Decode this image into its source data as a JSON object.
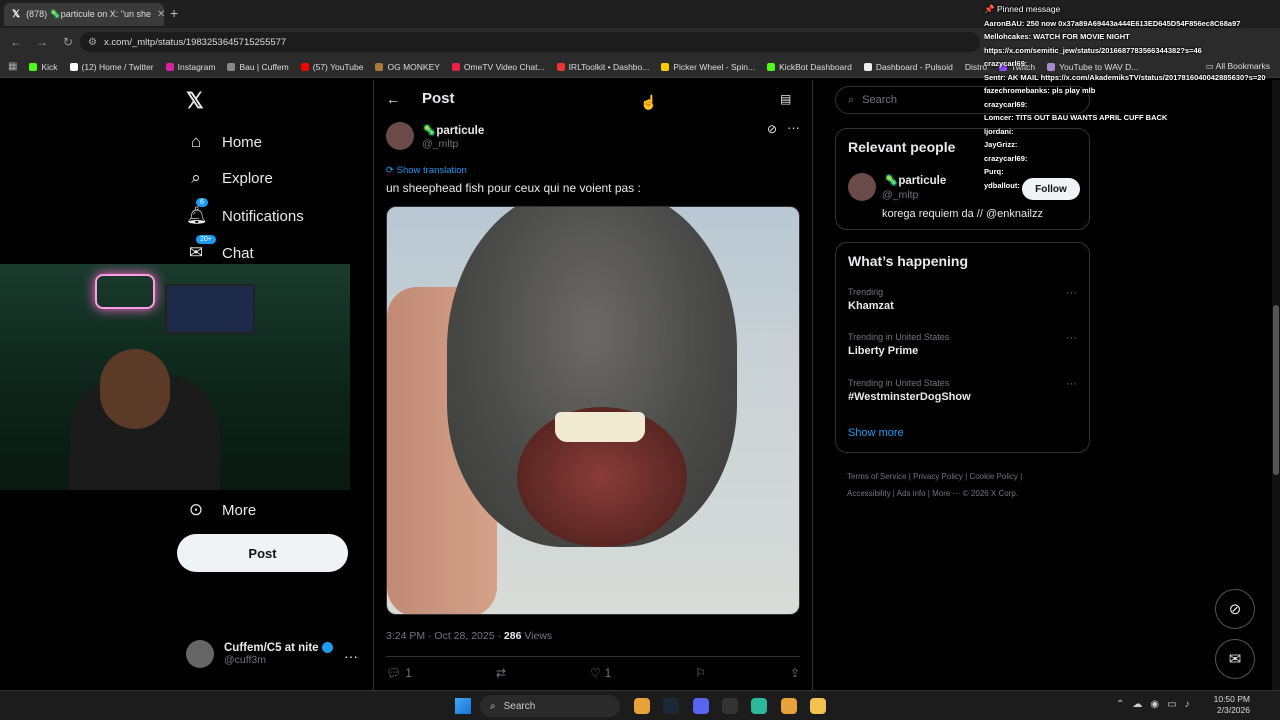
{
  "browser": {
    "tab_title": "(878) 🦠particule on X: \"un she",
    "url": "x.com/_mltp/status/1983253645715255577",
    "bookmarks": [
      "Kick",
      "(12) Home / Twitter",
      "Instagram",
      "Bau | Cuffem",
      "(57) YouTube",
      "OG MONKEY",
      "OmeTV Video Chat...",
      "IRLToolkit • Dashbo...",
      "Picker Wheel - Spin...",
      "KickBot Dashboard",
      "Dashboard - Pulsoid",
      "Distro",
      "Twitch",
      "YouTube to WAV D..."
    ],
    "all_bookmarks": "All Bookmarks"
  },
  "nav": {
    "home": "Home",
    "explore": "Explore",
    "notifications": "Notifications",
    "notifications_badge": "6",
    "chat": "Chat",
    "chat_badge": "20+",
    "more": "More",
    "post_button": "Post"
  },
  "account": {
    "name": "Cuffem/C5 at nite",
    "handle": "@cuff3m"
  },
  "post": {
    "header": "Post",
    "author_name": "🦠particule",
    "author_handle": "@_mltp",
    "translate": "Show translation",
    "text": "un sheephead fish pour ceux qui ne voient pas :",
    "time": "3:24 PM · Oct 28, 2025 ·",
    "views": "286",
    "views_label": "Views",
    "replies": "1",
    "likes": "1"
  },
  "sidebar": {
    "search_placeholder": "Search",
    "relevant_title": "Relevant people",
    "rp_name": "🦠particule",
    "rp_handle": "@_mltp",
    "rp_bio": "korega requiem da // @enknailzz",
    "follow": "Follow",
    "happening_title": "What’s happening",
    "trends": [
      {
        "label": "Trending",
        "topic": "Khamzat"
      },
      {
        "label": "Trending in United States",
        "topic": "Liberty Prime"
      },
      {
        "label": "Trending in United States",
        "topic": "#WestminsterDogShow"
      }
    ],
    "show_more": "Show more",
    "footer": [
      "Terms of Service",
      "Privacy Policy",
      "Cookie Policy",
      "Accessibility",
      "Ads info",
      "More ···",
      "© 2026 X Corp."
    ]
  },
  "chat": {
    "pinned": "Pinned message",
    "lines": [
      "AaronBAU: 250 now 0x37a89A69443a444E613ED645D54F856ec8C68a97",
      "Mellohcakes: WATCH FOR MOVIE NIGHT",
      "https://x.com/semitic_jew/status/2016687783566344382?s=46",
      "crazycarl69:",
      "Sentr: AK MAIL https://x.com/AkademiksTV/status/2017816040042885630?s=20",
      "fazechromebanks: pls play mlb",
      "crazycarl69:",
      "Lomcer: TITS OUT BAU WANTS APRIL CUFF BACK",
      "ljordani:",
      "JayGrizz:",
      "crazycarl69:",
      "Purq:",
      "ydballout:"
    ]
  },
  "taskbar": {
    "search": "Search",
    "time": "10:50 PM",
    "date": "2/3/2026"
  }
}
